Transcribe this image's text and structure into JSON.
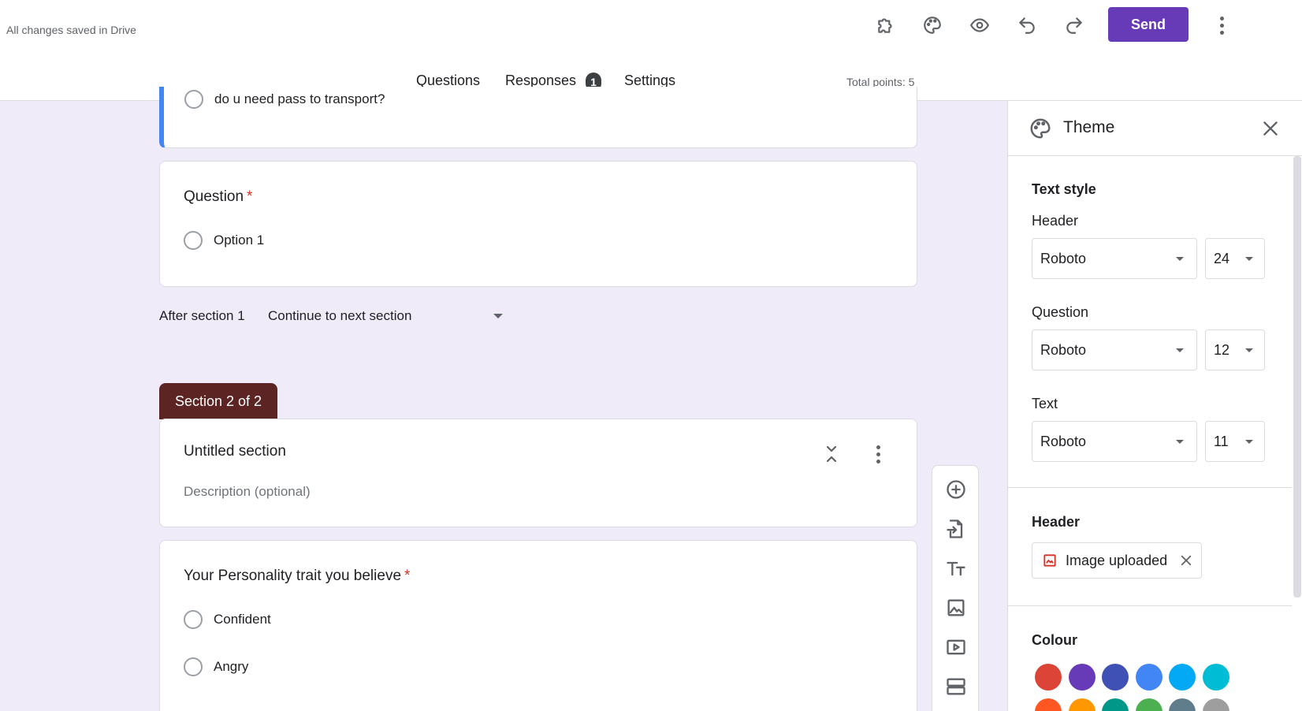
{
  "header": {
    "save_status": "All changes saved in Drive",
    "send_label": "Send",
    "icons": [
      "addons-icon",
      "palette-icon",
      "preview-icon",
      "undo-icon",
      "redo-icon",
      "more-vert-icon"
    ]
  },
  "tabs": {
    "questions": "Questions",
    "responses": "Responses",
    "responses_badge": "1",
    "settings": "Settings",
    "total_points": "Total points: 5"
  },
  "prev_question": {
    "option": "do u need pass to transport?"
  },
  "question_card": {
    "title": "Question",
    "required_mark": "*",
    "option": "Option 1"
  },
  "after_section": {
    "label": "After section 1",
    "value": "Continue to next section"
  },
  "section": {
    "tab_label": "Section 2 of 2",
    "title": "Untitled section",
    "description_placeholder": "Description (optional)"
  },
  "personality_card": {
    "title": "Your Personality trait you believe",
    "required_mark": "*",
    "options": [
      "Confident",
      "Angry"
    ]
  },
  "floating_toolbar": [
    "add-question-icon",
    "import-questions-icon",
    "add-title-icon",
    "add-image-icon",
    "add-video-icon",
    "add-section-icon"
  ],
  "theme_panel": {
    "title": "Theme",
    "text_style_heading": "Text style",
    "header_label": "Header",
    "header_font": "Roboto",
    "header_size": "24",
    "question_label": "Question",
    "question_font": "Roboto",
    "question_size": "12",
    "text_label": "Text",
    "text_font": "Roboto",
    "text_size": "11",
    "header_section_heading": "Header",
    "image_chip": "Image uploaded",
    "colour_heading": "Colour",
    "colours_row1": [
      "#db4437",
      "#673ab7",
      "#3f51b5",
      "#4285f4",
      "#03a9f4",
      "#00bcd4"
    ],
    "colours_row2": [
      "#ff5722",
      "#ff9800",
      "#009688",
      "#4caf50",
      "#607d8b",
      "#9e9e9e"
    ]
  }
}
